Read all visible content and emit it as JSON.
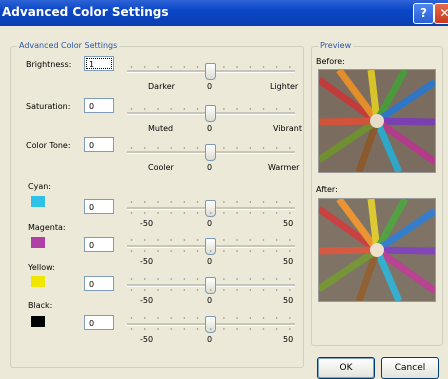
{
  "window": {
    "title": "Advanced Color Settings",
    "help_label": "?",
    "close_label": "✕"
  },
  "group_settings": {
    "legend": "Advanced Color Settings"
  },
  "group_preview": {
    "legend": "Preview",
    "before_label": "Before:",
    "after_label": "After:"
  },
  "brightness": {
    "label": "Brightness:",
    "value": "1",
    "min_label": "Darker",
    "mid_label": "0",
    "max_label": "Lighter"
  },
  "saturation": {
    "label": "Saturation:",
    "value": "0",
    "min_label": "Muted",
    "mid_label": "0",
    "max_label": "Vibrant"
  },
  "color_tone": {
    "label": "Color Tone:",
    "value": "0",
    "min_label": "Cooler",
    "mid_label": "0",
    "max_label": "Warmer"
  },
  "cyan": {
    "label": "Cyan:",
    "value": "0",
    "min_label": "-50",
    "mid_label": "0",
    "max_label": "50",
    "color": "#2ec3e6"
  },
  "magenta": {
    "label": "Magenta:",
    "value": "0",
    "min_label": "-50",
    "mid_label": "0",
    "max_label": "50",
    "color": "#b03fa6"
  },
  "yellow": {
    "label": "Yellow:",
    "value": "0",
    "min_label": "-50",
    "mid_label": "0",
    "max_label": "50",
    "color": "#f0e600"
  },
  "black": {
    "label": "Black:",
    "value": "0",
    "min_label": "-50",
    "mid_label": "0",
    "max_label": "50",
    "color": "#000000"
  },
  "buttons": {
    "ok": "OK",
    "cancel": "Cancel"
  },
  "icons": {
    "help": "help-icon",
    "close": "close-icon"
  }
}
